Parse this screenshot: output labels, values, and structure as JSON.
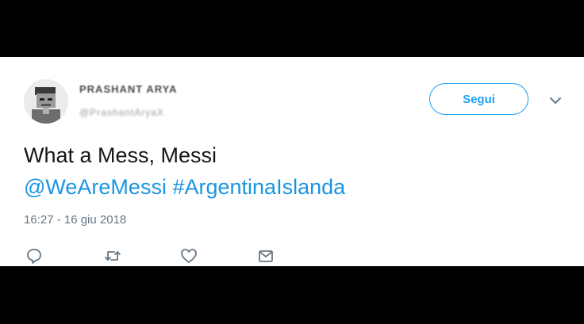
{
  "author": {
    "name": "PRASHANT ARYA",
    "handle": "@PrashantAryaX"
  },
  "follow_button": {
    "label": "Segui"
  },
  "tweet": {
    "text": "What a Mess, Messi",
    "mention": "@WeAreMessi",
    "hashtag": "#ArgentinaIslanda",
    "timestamp": "16:27 - 16 giu 2018"
  },
  "actions": {
    "icons": [
      "reply-icon",
      "retweet-icon",
      "like-icon",
      "direct-message-icon"
    ]
  },
  "colors": {
    "accent": "#1da1f2",
    "link": "#1b95e0",
    "text": "#14171a",
    "muted": "#657786",
    "letterbox": "#000000"
  }
}
